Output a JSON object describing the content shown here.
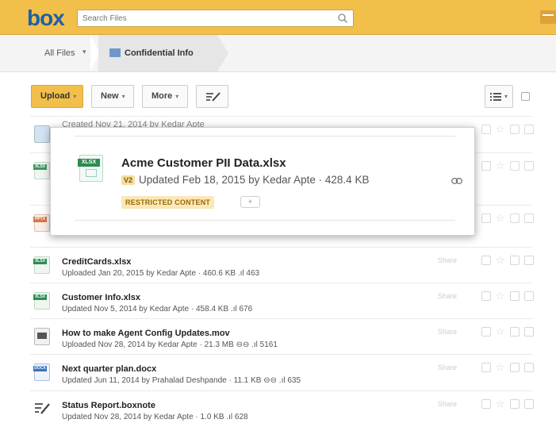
{
  "header": {
    "logo": "box",
    "search_placeholder": "Search Files"
  },
  "breadcrumb": {
    "root": "All Files",
    "current": "Confidential Info"
  },
  "toolbar": {
    "upload_label": "Upload",
    "new_label": "New",
    "more_label": "More"
  },
  "ghost_rows": [
    {
      "name": "",
      "meta": "Created Nov 21, 2014 by Kedar Apte"
    },
    {
      "name": "",
      "meta": ""
    },
    {
      "name": "",
      "meta": ""
    }
  ],
  "popup": {
    "icon_label": "XLSX",
    "title": "Acme Customer PII Data.xlsx",
    "version": "V2",
    "meta": "Updated Feb 18, 2015 by Kedar Apte  ·  428.4 KB",
    "badge": "RESTRICTED CONTENT",
    "tag_button": "+"
  },
  "files": [
    {
      "icon": "XLSX",
      "name": "CreditCards.xlsx",
      "meta": "Uploaded Jan 20, 2015 by Kedar Apte  ·  460.6 KB  .ıl 463",
      "share": "Share"
    },
    {
      "icon": "XLSX",
      "name": "Customer Info.xlsx",
      "meta": "Updated Nov 5, 2014 by Kedar Apte  ·  458.4 KB  .ıl 676",
      "share": "Share"
    },
    {
      "icon": "MOV",
      "name": "How to make Agent Config Updates.mov",
      "meta": "Uploaded Nov 28, 2014 by Kedar Apte  ·  21.3 MB  ⊖⊖  .ıl 5161",
      "share": "Share"
    },
    {
      "icon": "DOCX",
      "name": "Next quarter plan.docx",
      "meta": "Updated Jun 11, 2014 by Prahalad Deshpande  ·  11.1 KB  ⊖⊖  .ıl 635",
      "share": "Share"
    },
    {
      "icon": "NOTE",
      "name": "Status Report.boxnote",
      "meta": "Updated Nov 28, 2014 by Kedar Apte  ·  1.0 KB  .ıl 628",
      "share": "Share"
    }
  ],
  "colors": {
    "brand_yellow": "#f2c04a",
    "logo_blue": "#1f5fa8",
    "xlsx_green": "#2e8b50",
    "docx_blue": "#3b73b9"
  }
}
